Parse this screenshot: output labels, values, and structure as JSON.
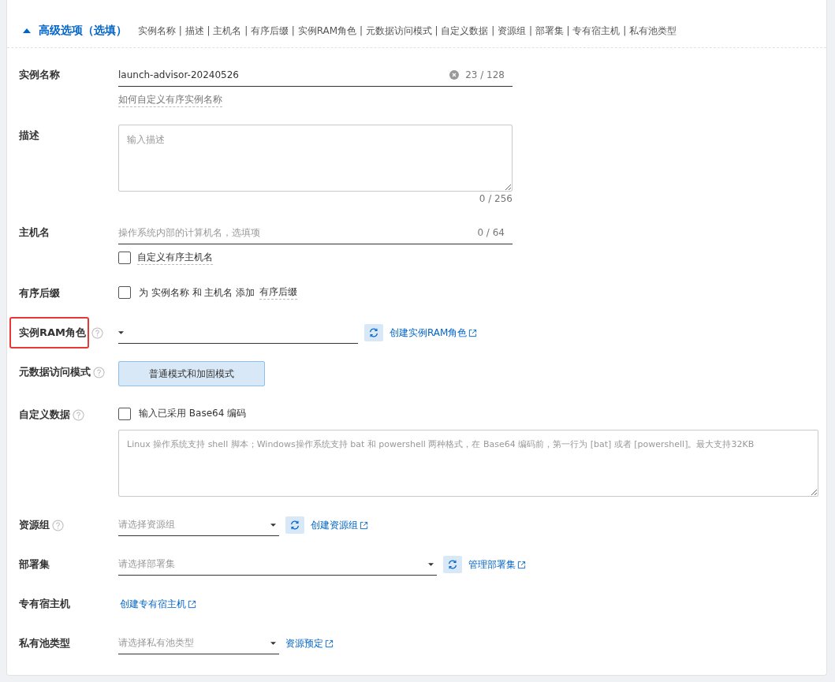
{
  "header": {
    "expanded": true,
    "title": "高级选项（选填）",
    "summary": "实例名称 | 描述 | 主机名 | 有序后缀 | 实例RAM角色 | 元数据访问模式 | 自定义数据 | 资源组 | 部署集 | 专有宿主机 | 私有池类型"
  },
  "fields": [
    {
      "kind": "text",
      "label": "实例名称",
      "value": "launch-advisor-20240526",
      "clearable": true,
      "counter": "23 / 128",
      "hint": "如何自定义有序实例名称"
    },
    {
      "kind": "textarea",
      "label": "描述",
      "placeholder": "输入描述",
      "counter": "0 / 256"
    },
    {
      "kind": "text",
      "label": "主机名",
      "placeholder": "操作系统内部的计算机名，选填项",
      "counter": "0 / 64",
      "checkbox": {
        "label": "自定义有序主机名",
        "checked": false
      }
    },
    {
      "kind": "checkbox",
      "label": "有序后缀",
      "checkbox": {
        "label": "为 实例名称 和 主机名 添加",
        "link": "有序后缀",
        "checked": false
      }
    },
    {
      "kind": "select",
      "label": "实例RAM角色",
      "help": true,
      "highlighted": true,
      "refresh": true,
      "link": "创建实例RAM角色"
    },
    {
      "kind": "toggle",
      "label": "元数据访问模式",
      "help": true,
      "options": [
        {
          "label": "普通模式和加固模式",
          "selected": true
        }
      ]
    },
    {
      "kind": "userdata",
      "label": "自定义数据",
      "help": true,
      "checkbox": {
        "label": "输入已采用 Base64 编码",
        "checked": false
      },
      "placeholder": "Linux 操作系统支持 shell 脚本；Windows操作系统支持 bat 和 powershell 两种格式，在 Base64 编码前，第一行为 [bat] 或者 [powershell]。最大支持32KB"
    },
    {
      "kind": "select",
      "label": "资源组",
      "help": true,
      "placeholder": "请选择资源组",
      "refresh": true,
      "link": "创建资源组"
    },
    {
      "kind": "select",
      "label": "部署集",
      "placeholder": "请选择部署集",
      "refresh": true,
      "link": "管理部署集"
    },
    {
      "kind": "link",
      "label": "专有宿主机",
      "link": "创建专有宿主机"
    },
    {
      "kind": "select",
      "label": "私有池类型",
      "placeholder": "请选择私有池类型",
      "link": "资源预定"
    }
  ]
}
